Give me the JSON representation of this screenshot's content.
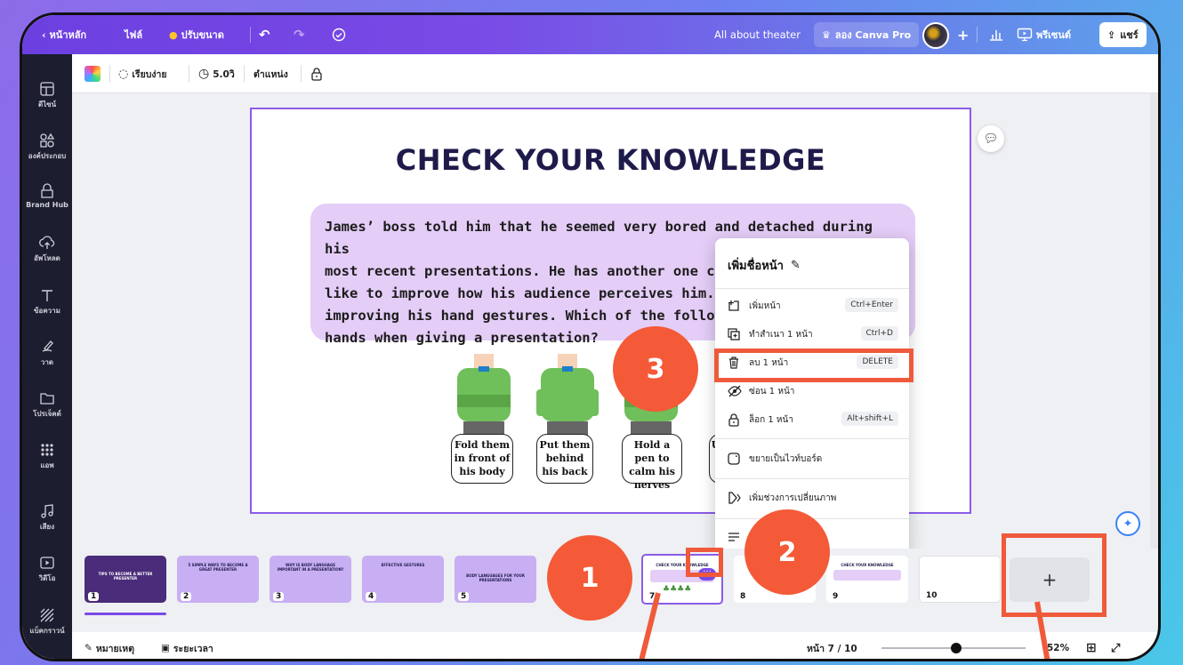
{
  "topbar": {
    "back_label": "หน้าหลัก",
    "file_label": "ไฟล์",
    "resize_label": "ปรับขนาด",
    "doc_title": "All about theater",
    "try_pro_label": "ลอง Canva Pro",
    "present_label": "พรีเซนต์",
    "share_label": "แชร์"
  },
  "sidebar": {
    "items": [
      {
        "label": "ดีไซน์",
        "icon": "layout-icon"
      },
      {
        "label": "องค์ประกอบ",
        "icon": "elements-icon"
      },
      {
        "label": "Brand Hub",
        "icon": "brand-icon"
      },
      {
        "label": "อัพโหลด",
        "icon": "upload-icon"
      },
      {
        "label": "ข้อความ",
        "icon": "text-icon"
      },
      {
        "label": "วาด",
        "icon": "draw-icon"
      },
      {
        "label": "โปรเจ็คต์",
        "icon": "folder-icon"
      },
      {
        "label": "แอพ",
        "icon": "apps-icon"
      },
      {
        "label": "เสียง",
        "icon": "audio-icon"
      },
      {
        "label": "วิดีโอ",
        "icon": "video-icon"
      },
      {
        "label": "แบ็คกราวน์",
        "icon": "background-icon"
      }
    ]
  },
  "toolbar": {
    "animate_label": "เรียบง่าย",
    "duration_label": "5.0วิ",
    "position_label": "ตำแหน่ง"
  },
  "slide": {
    "title": "CHECK YOUR KNOWLEDGE",
    "question_lines": [
      "James’ boss told him that he seemed very bored and detached during his",
      "most recent presentations. He has another one com",
      "like to improve how his audience perceives him. H",
      "improving his hand gestures. Which of the following",
      "hands when giving a presentation?"
    ],
    "options": [
      "Fold them in front of his body",
      "Put them behind his back",
      "Hold a pen to calm his nerves",
      "U"
    ]
  },
  "context_menu": {
    "title": "เพิ่มชื่อหน้า",
    "items": [
      {
        "label": "เพิ่มหน้า",
        "shortcut": "Ctrl+Enter",
        "icon": "add-page-icon"
      },
      {
        "label": "ทำสำเนา 1 หน้า",
        "shortcut": "Ctrl+D",
        "icon": "duplicate-icon"
      },
      {
        "label": "ลบ 1 หน้า",
        "shortcut": "DELETE",
        "icon": "trash-icon"
      },
      {
        "label": "ซ่อน 1 หน้า",
        "shortcut": "",
        "icon": "hide-icon"
      },
      {
        "label": "ล็อก 1 หน้า",
        "shortcut": "Alt+shift+L",
        "icon": "lock-icon"
      },
      {
        "label": "ขยายเป็นไวท์บอร์ด",
        "shortcut": "",
        "icon": "whiteboard-icon"
      },
      {
        "label": "เพิ่มช่วงการเปลี่ยนภาพ",
        "shortcut": "",
        "icon": "transition-icon"
      }
    ]
  },
  "filmstrip": {
    "thumbnails": [
      {
        "num": "1",
        "title": "TIPS TO BECOME A BETTER PRESENTER"
      },
      {
        "num": "2",
        "title": "5 SIMPLE WAYS TO BECOME A GREAT PRESENTER"
      },
      {
        "num": "3",
        "title": "WHY IS BODY LANGUAGE IMPORTANT IN A PRESENTATION?"
      },
      {
        "num": "4",
        "title": "EFFECTIVE GESTURES"
      },
      {
        "num": "5",
        "title": "BODY LANGUAGES FOR YOUR PRESENTATIONS"
      },
      {
        "num": "7",
        "title": "CHECK YOUR KNOWLEDGE"
      },
      {
        "num": "8",
        "title": ""
      },
      {
        "num": "9",
        "title": "CHECK YOUR KNOWLEDGE"
      },
      {
        "num": "10",
        "title": ""
      }
    ],
    "add_label": "+"
  },
  "bottombar": {
    "notes_label": "หมายเหตุ",
    "timer_label": "ระยะเวลา",
    "page_indicator": "หน้า 7 / 10",
    "zoom": "52%",
    "zoom_fraction": 0.52
  },
  "annotations": {
    "step1": "1",
    "step2": "2",
    "step3": "3",
    "accent": "#f45a37"
  },
  "colors": {
    "brand_purple": "#7a4ae6",
    "slide_border": "#8b5ce6",
    "question_bg": "#e4cdf7"
  }
}
